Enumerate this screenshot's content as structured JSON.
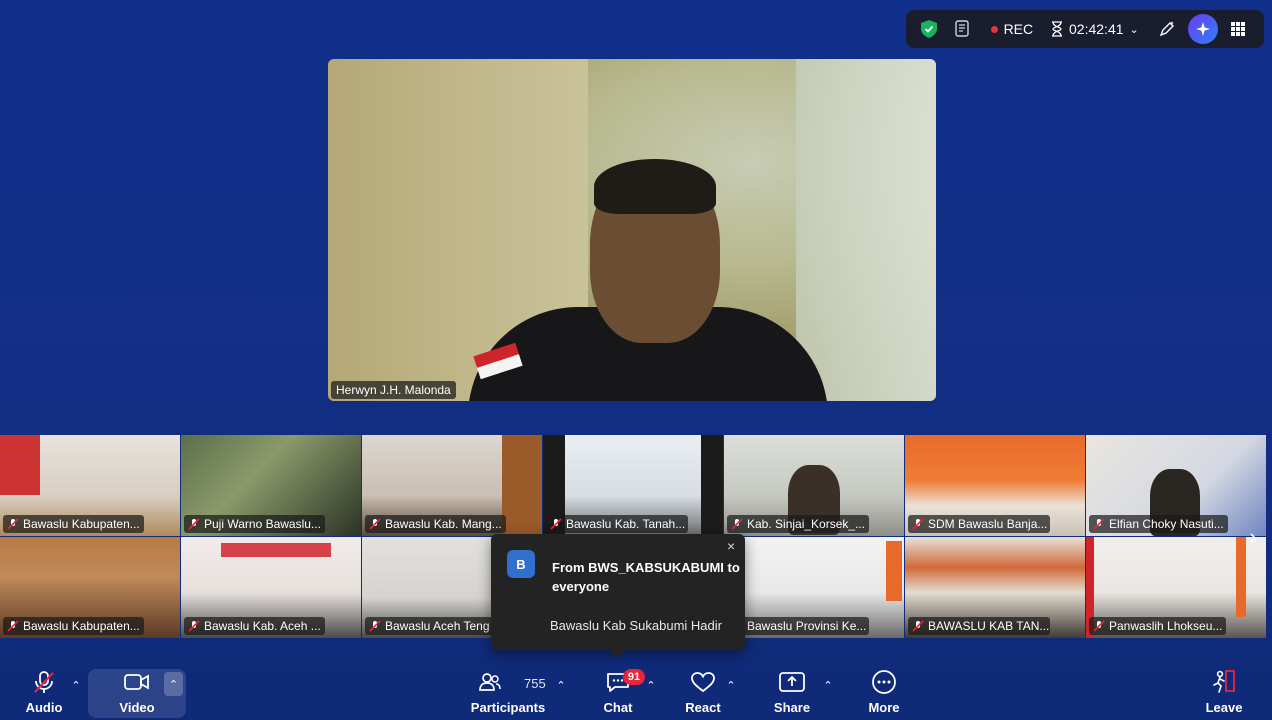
{
  "status_bar": {
    "rec_label": "REC",
    "timer": "02:42:41"
  },
  "speaker": {
    "name": "Herwyn J.H. Malonda"
  },
  "thumbnails": [
    {
      "name": "Bawaslu Kabupaten..."
    },
    {
      "name": "Puji Warno Bawaslu..."
    },
    {
      "name": "Bawaslu Kab. Mang..."
    },
    {
      "name": "Bawaslu Kab. Tanah..."
    },
    {
      "name": "Kab. Sinjai_Korsek_..."
    },
    {
      "name": "SDM Bawaslu Banja..."
    },
    {
      "name": "Elfian Choky Nasuti..."
    },
    {
      "name": "Bawaslu Kabupaten..."
    },
    {
      "name": "Bawaslu Kab. Aceh ..."
    },
    {
      "name": "Bawaslu Aceh Teng"
    },
    {
      "name": ""
    },
    {
      "name": "Bawaslu Provinsi Ke..."
    },
    {
      "name": "BAWASLU KAB TAN..."
    },
    {
      "name": "Panwaslih Lhokseu..."
    }
  ],
  "chat_popup": {
    "avatar_letter": "B",
    "from": "From BWS_KABSUKABUMI to everyone",
    "message": "Bawaslu Kab Sukabumi Hadir",
    "close_icon": "×"
  },
  "toolbar": {
    "audio_label": "Audio",
    "video_label": "Video",
    "participants_label": "Participants",
    "participants_count": "755",
    "chat_label": "Chat",
    "chat_badge": "91",
    "react_label": "React",
    "share_label": "Share",
    "more_label": "More",
    "leave_label": "Leave"
  },
  "colors": {
    "background": "#132f86",
    "leave": "#e8253b",
    "rec_dot": "#e8333a",
    "shield": "#19b35c"
  }
}
